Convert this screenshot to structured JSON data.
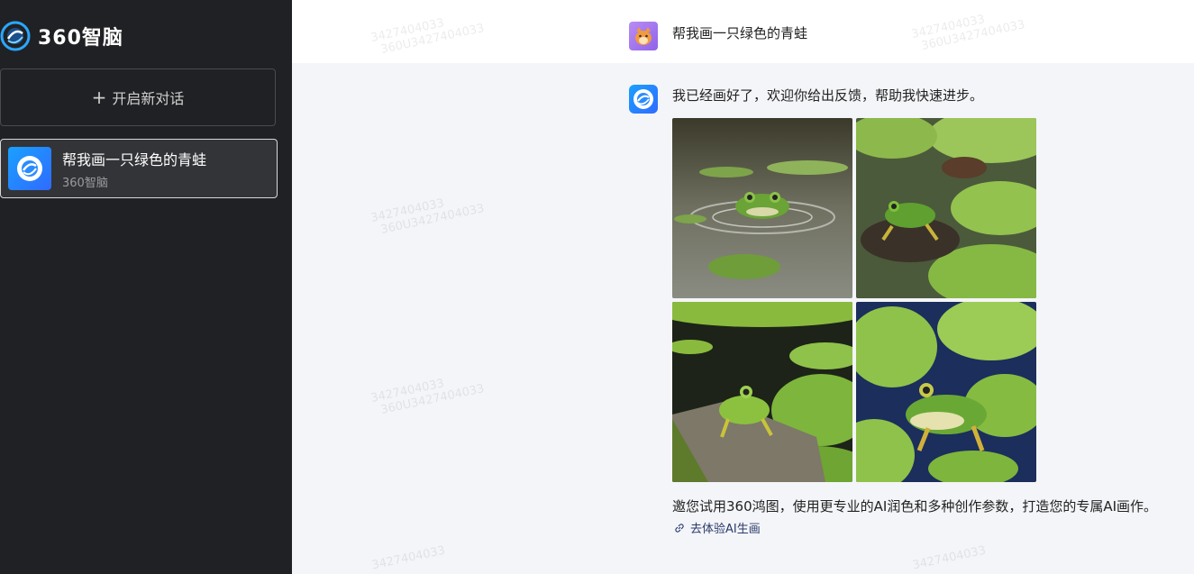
{
  "sidebar": {
    "logo_text": "360智脑",
    "new_chat_label": "开启新对话",
    "conversations": [
      {
        "title": "帮我画一只绿色的青蛙",
        "subtitle": "360智脑"
      }
    ]
  },
  "chat": {
    "user_message": "帮我画一只绿色的青蛙",
    "bot_message": "我已经画好了，欢迎你给出反馈，帮助我快速进步。",
    "images": [
      {
        "icon": "frog-in-water-image"
      },
      {
        "icon": "frog-on-lilypad-image"
      },
      {
        "icon": "frog-on-rock-image"
      },
      {
        "icon": "frog-on-leaf-image"
      }
    ],
    "invite_text": "邀您试用360鸿图，使用更专业的AI润色和多种创作参数，打造您的专属AI画作。",
    "try_link": "去体验AI生画"
  },
  "watermark": {
    "line1": "3427404033",
    "line2": "360U3427404033"
  },
  "colors": {
    "sidebar_bg": "#202124",
    "brand_blue": "#1aa0ff",
    "main_bg": "#f4f5f8"
  }
}
